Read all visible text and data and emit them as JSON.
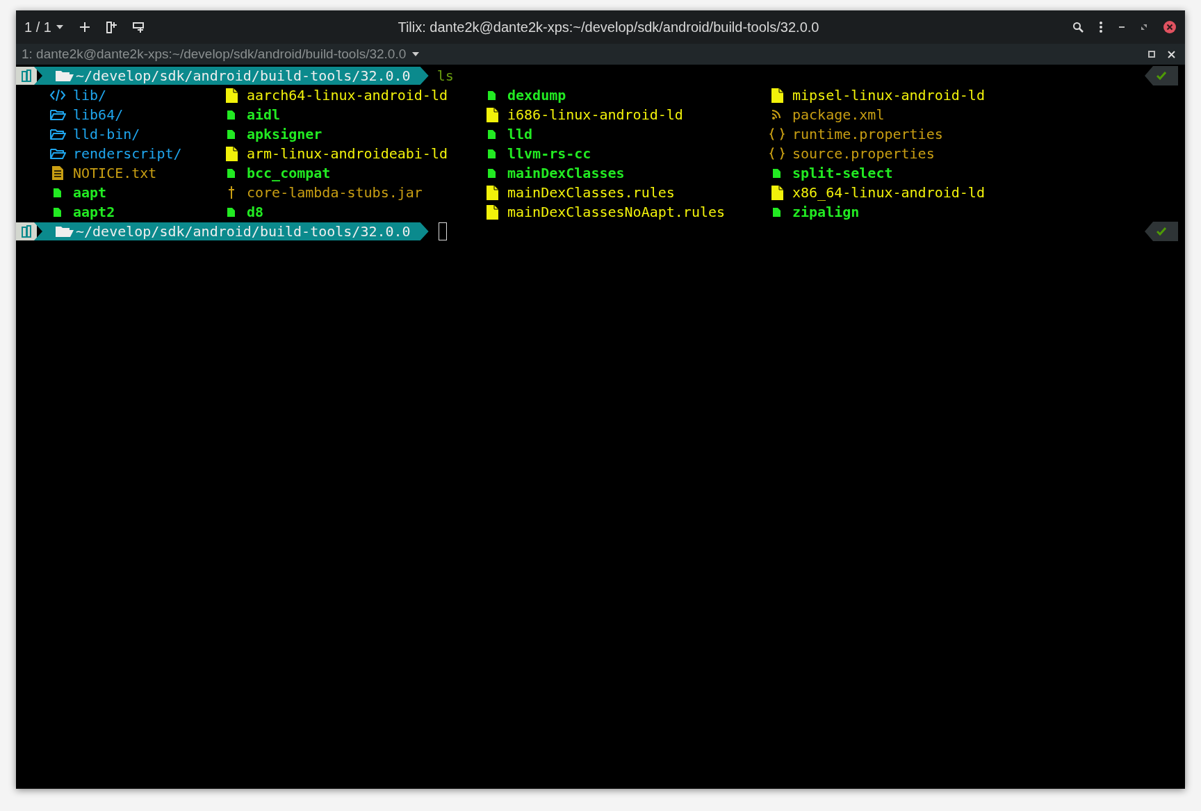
{
  "window": {
    "title": "Tilix: dante2k@dante2k-xps:~/develop/sdk/android/build-tools/32.0.0",
    "session_counter": "1 / 1"
  },
  "terminal": {
    "title": "1: dante2k@dante2k-xps:~/develop/sdk/android/build-tools/32.0.0"
  },
  "session": [
    {
      "kind": "prompt",
      "path": "~/develop/sdk/android/build-tools/32.0.0",
      "command": "ls",
      "succeeded": true
    },
    {
      "kind": "listing",
      "columns": [
        [
          {
            "name": "lib/",
            "kind": "code-dir"
          },
          {
            "name": "lib64/",
            "kind": "dir"
          },
          {
            "name": "lld-bin/",
            "kind": "dir"
          },
          {
            "name": "renderscript/",
            "kind": "dir"
          },
          {
            "name": "NOTICE.txt",
            "kind": "text"
          },
          {
            "name": "aapt",
            "kind": "exec"
          },
          {
            "name": "aapt2",
            "kind": "exec"
          }
        ],
        [
          {
            "name": "aarch64-linux-android-ld",
            "kind": "file"
          },
          {
            "name": "aidl",
            "kind": "exec"
          },
          {
            "name": "apksigner",
            "kind": "exec"
          },
          {
            "name": "arm-linux-androideabi-ld",
            "kind": "file"
          },
          {
            "name": "bcc_compat",
            "kind": "exec"
          },
          {
            "name": "core-lambda-stubs.jar",
            "kind": "jar"
          },
          {
            "name": "d8",
            "kind": "exec"
          }
        ],
        [
          {
            "name": "dexdump",
            "kind": "exec"
          },
          {
            "name": "i686-linux-android-ld",
            "kind": "file"
          },
          {
            "name": "lld",
            "kind": "exec"
          },
          {
            "name": "llvm-rs-cc",
            "kind": "exec"
          },
          {
            "name": "mainDexClasses",
            "kind": "exec"
          },
          {
            "name": "mainDexClasses.rules",
            "kind": "file"
          },
          {
            "name": "mainDexClassesNoAapt.rules",
            "kind": "file"
          }
        ],
        [
          {
            "name": "mipsel-linux-android-ld",
            "kind": "file"
          },
          {
            "name": "package.xml",
            "kind": "xml"
          },
          {
            "name": "runtime.properties",
            "kind": "props"
          },
          {
            "name": "source.properties",
            "kind": "props"
          },
          {
            "name": "split-select",
            "kind": "exec"
          },
          {
            "name": "x86_64-linux-android-ld",
            "kind": "file"
          },
          {
            "name": "zipalign",
            "kind": "exec"
          }
        ]
      ]
    },
    {
      "kind": "prompt",
      "path": "~/develop/sdk/android/build-tools/32.0.0",
      "cursor": true,
      "succeeded": true
    }
  ]
}
